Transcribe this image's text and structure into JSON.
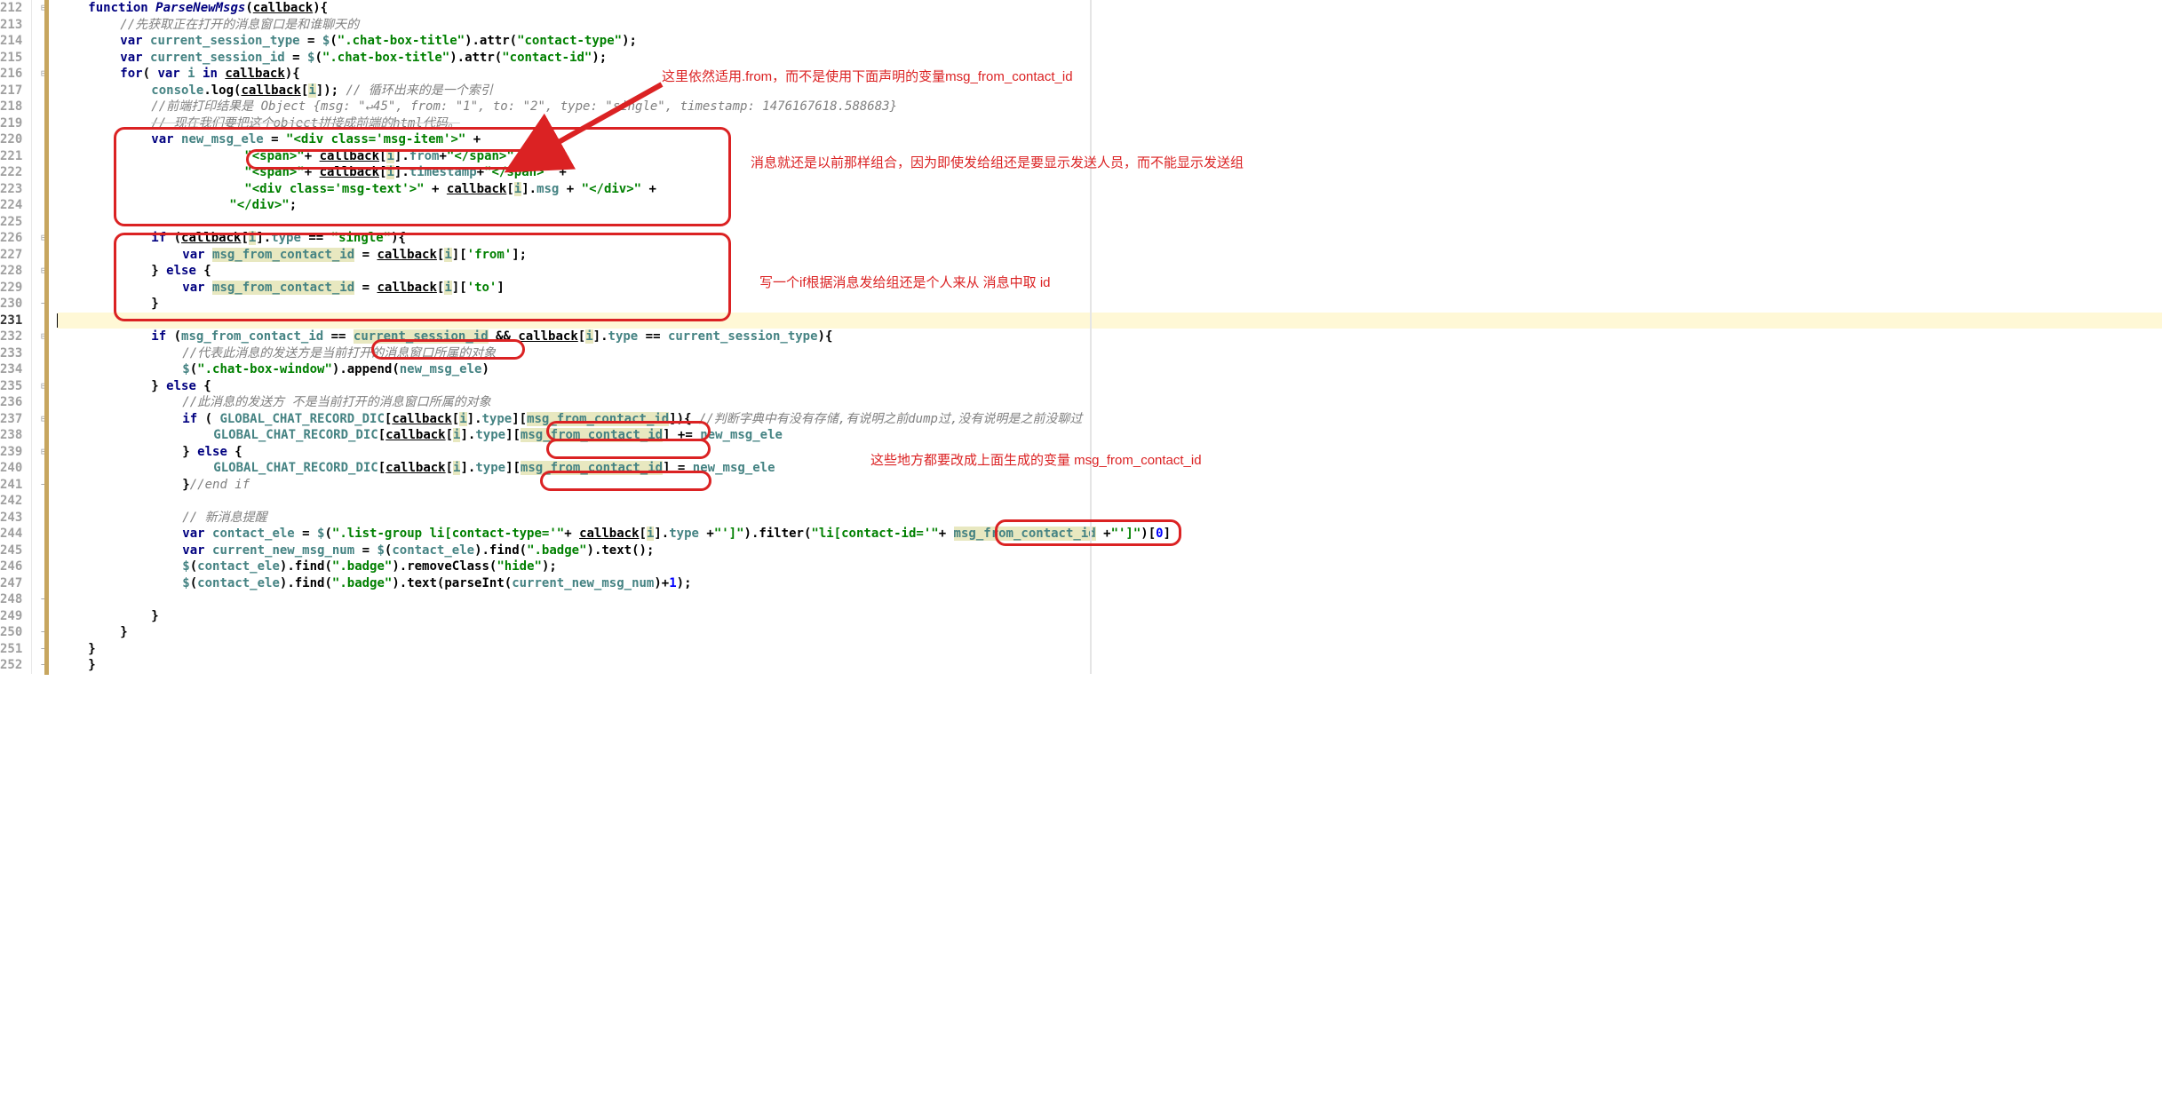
{
  "lineNumbers": [
    "212",
    "213",
    "214",
    "215",
    "216",
    "217",
    "218",
    "219",
    "220",
    "221",
    "222",
    "223",
    "224",
    "225",
    "226",
    "227",
    "228",
    "229",
    "230",
    "231",
    "232",
    "233",
    "234",
    "235",
    "236",
    "237",
    "238",
    "239",
    "240",
    "241",
    "242",
    "243",
    "244",
    "245",
    "246",
    "247",
    "248",
    "249",
    "250",
    "251",
    "252"
  ],
  "currentLine": "231",
  "annotations": {
    "a1": "这里依然适用.from，而不是使用下面声明的变量msg_from_contact_id",
    "a2": "消息就还是以前那样组合，因为即使发给组还是要显示发送人员，而不能显示发送组",
    "a3": "写一个if根据消息发给组还是个人来从 消息中取 id",
    "a4": "这些地方都要改成上面生成的变量 msg_from_contact_id"
  },
  "code": {
    "l212": {
      "p": "function ",
      "fn": "ParseNewMsgs",
      "args": "callback",
      "t": "(",
      "t2": "){"
    },
    "l213": "//先获取正在打开的消息窗口是和谁聊天的",
    "l214": {
      "kw": "var ",
      "id": "current_session_type",
      "eq": " = ",
      "d": "$",
      "s1": "\".chat-box-title\"",
      "m": ".attr(",
      "s2": "\"contact-type\"",
      "end": ");"
    },
    "l215": {
      "kw": "var ",
      "id": "current_session_id",
      "eq": " = ",
      "d": "$",
      "s1": "\".chat-box-title\"",
      "m": ".attr(",
      "s2": "\"contact-id\"",
      "end": ");"
    },
    "l216": {
      "kw": "for",
      "p1": "( ",
      "kw2": "var ",
      "id": "i",
      "kw3": " in ",
      "cb": "callback",
      "p2": "){"
    },
    "l217": {
      "id": "console",
      "m": ".log(",
      "cb": "callback",
      "br": "[",
      "i": "i",
      "end": "]); ",
      "cm": "// 循环出来的是一个索引"
    },
    "l218": "//前端打印结果是 Object {msg: \"↵45\", from: \"1\", to: \"2\", type: \"single\", timestamp: 1476167618.588683}",
    "l219": "// 现在我们要把这个object拼接成前端的html代码。",
    "l220": {
      "kw": "var ",
      "id": "new_msg_ele",
      "eq": " = ",
      "s": "\"<div class='msg-item'>\"",
      "plus": " +"
    },
    "l221": {
      "s1": "\"<span>\"",
      "p1": "+ ",
      "cb": "callback",
      "br": "[",
      "i": "i",
      "p2": "].",
      "id": "from",
      "p3": "+",
      "s2": "\"</span>\"",
      "plus": " +"
    },
    "l222": {
      "s1": "\"<span>\"",
      "p1": "+ ",
      "cb": "callback",
      "br": "[",
      "i": "i",
      "p2": "].",
      "id": "timestamp",
      "p3": "+",
      "s2": "\"</span>\"",
      "plus": " +"
    },
    "l223": {
      "s1": "\"<div class='msg-text'>\"",
      "p1": " + ",
      "cb": "callback",
      "br": "[",
      "i": "i",
      "p2": "].",
      "id": "msg",
      "p3": " + ",
      "s2": "\"</div>\"",
      "plus": " +"
    },
    "l224": {
      "s": "\"</div>\"",
      "end": ";"
    },
    "l226": {
      "kw": "if ",
      "p1": "(",
      "cb": "callback",
      "br": "[",
      "i": "i",
      "p2": "].",
      "id": "type",
      "eq": " == ",
      "s": "\"single\"",
      "p3": "){"
    },
    "l227": {
      "kw": "var ",
      "id": "msg_from_contact_id",
      "eq": " = ",
      "cb": "callback",
      "br": "[",
      "i": "i",
      "p2": "][",
      "s": "'from'",
      "end": "];"
    },
    "l228": {
      "p1": "} ",
      "kw": "else",
      "p2": " {"
    },
    "l229": {
      "kw": "var ",
      "id": "msg_from_contact_id",
      "eq": " = ",
      "cb": "callback",
      "br": "[",
      "i": "i",
      "p2": "][",
      "s": "'to'",
      "end": "]"
    },
    "l230": "}",
    "l232": {
      "kw": "if ",
      "p1": "(",
      "id1": "msg_from_contact_id",
      "eq": " == ",
      "id2": "current_session_id",
      "and": " && ",
      "cb": "callback",
      "br": "[",
      "i": "i",
      "p2": "].",
      "id3": "type",
      "eq2": " == ",
      "id4": "current_session_type",
      "p3": "){"
    },
    "l233": "//代表此消息的发送方是当前打开的消息窗口所属的对象",
    "l234": {
      "d": "$",
      "p1": "(",
      "s": "\".chat-box-window\"",
      "p2": ").append(",
      "id": "new_msg_ele",
      "end": ")"
    },
    "l235": {
      "p1": "} ",
      "kw": "else",
      "p2": " {"
    },
    "l236": "//此消息的发送方 不是当前打开的消息窗口所属的对象",
    "l237": {
      "kw": "if ",
      "p1": "( ",
      "id": "GLOBAL_CHAT_RECORD_DIC",
      "br": "[",
      "cb": "callback",
      "br2": "[",
      "i": "i",
      "p2": "].",
      "id2": "type",
      "p3": "][",
      "id3": "msg_from_contact_id",
      "p4": "]){ ",
      "cm": "//判断字典中有没有存储,有说明之前dump过,没有说明是之前没聊过"
    },
    "l238": {
      "id": "GLOBAL_CHAT_RECORD_DIC",
      "br": "[",
      "cb": "callback",
      "br2": "[",
      "i": "i",
      "p2": "].",
      "id2": "type",
      "p3": "][",
      "id3": "msg_from_contact_id",
      "p4": "] += ",
      "id4": "new_msg_ele"
    },
    "l239": {
      "p1": "} ",
      "kw": "else",
      "p2": " {"
    },
    "l240": {
      "id": "GLOBAL_CHAT_RECORD_DIC",
      "br": "[",
      "cb": "callback",
      "br2": "[",
      "i": "i",
      "p2": "].",
      "id2": "type",
      "p3": "][",
      "id3": "msg_from_contact_id",
      "p4": "] = ",
      "id4": "new_msg_ele"
    },
    "l241": {
      "p": "}",
      "cm": "//end if"
    },
    "l243": "// 新消息提醒",
    "l244": {
      "kw": "var ",
      "id": "contact_ele",
      "eq": " = ",
      "d": "$",
      "p1": "(",
      "s1": "\".list-group li[contact-type='\"",
      "p2": "+ ",
      "cb": "callback",
      "br": "[",
      "i": "i",
      "p3": "].",
      "id2": "type",
      "p4": " +",
      "s2": "\"']\"",
      "p5": ").filter(",
      "s3": "\"li[contact-id='\"",
      "p6": "+ ",
      "id3": "msg_from_contact_id",
      "p7": " +",
      "s4": "\"']\"",
      "end": ")[",
      "num": "0",
      "end2": "]"
    },
    "l245": {
      "kw": "var ",
      "id": "current_new_msg_num",
      "eq": " = ",
      "d": "$",
      "p1": "(",
      "id2": "contact_ele",
      "p2": ").find(",
      "s": "\".badge\"",
      "end": ").text();"
    },
    "l246": {
      "d": "$",
      "p1": "(",
      "id": "contact_ele",
      "p2": ").find(",
      "s1": "\".badge\"",
      "p3": ").removeClass(",
      "s2": "\"hide\"",
      "end": ");"
    },
    "l247": {
      "d": "$",
      "p1": "(",
      "id": "contact_ele",
      "p2": ").find(",
      "s1": "\".badge\"",
      "p3": ").text(parseInt(",
      "id2": "current_new_msg_num",
      "p4": ")+",
      "num": "1",
      "end": ");"
    },
    "l249": "}",
    "l250": "}",
    "l251": "}",
    "l252": "}"
  }
}
